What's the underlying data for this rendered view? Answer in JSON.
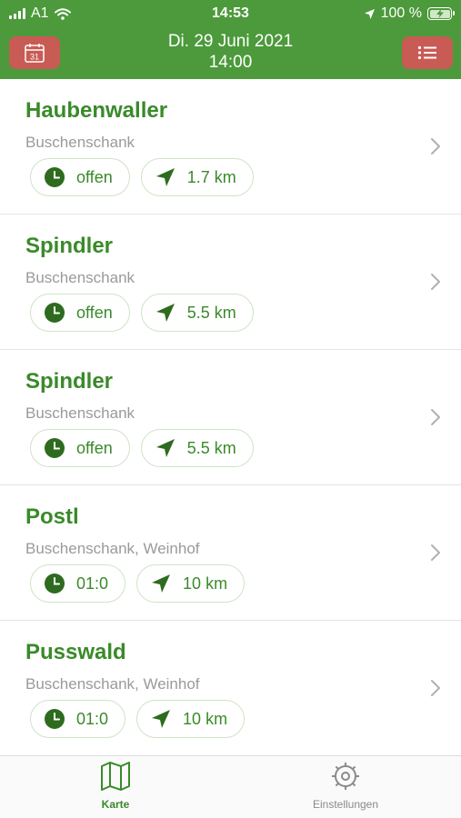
{
  "status_bar": {
    "carrier": "A1",
    "time": "14:53",
    "battery": "100 %"
  },
  "header": {
    "date": "Di. 29 Juni 2021",
    "time": "14:00",
    "calendar_day": "31",
    "background_color": "#4c9a3b",
    "button_color": "#c85b54"
  },
  "listings": [
    {
      "name": "Haubenwaller",
      "type": "Buschenschank",
      "status": "offen",
      "distance": "1.7 km"
    },
    {
      "name": "Spindler",
      "type": "Buschenschank",
      "status": "offen",
      "distance": "5.5 km"
    },
    {
      "name": "Spindler",
      "type": "Buschenschank",
      "status": "offen",
      "distance": "5.5 km"
    },
    {
      "name": "Postl",
      "type": "Buschenschank, Weinhof",
      "status": "01:0",
      "distance": "10 km"
    },
    {
      "name": "Pusswald",
      "type": "Buschenschank, Weinhof",
      "status": "01:0",
      "distance": "10 km"
    }
  ],
  "icons": {
    "status": "clock-icon",
    "distance": "location-arrow-icon",
    "row_action": "chevron-right-icon"
  },
  "tabbar": {
    "karte": "Karte",
    "einstellungen": "Einstellungen"
  },
  "colors": {
    "accent": "#3a8a2a",
    "chip_border": "#cfe3c8",
    "subtitle": "#9a9a9a"
  }
}
